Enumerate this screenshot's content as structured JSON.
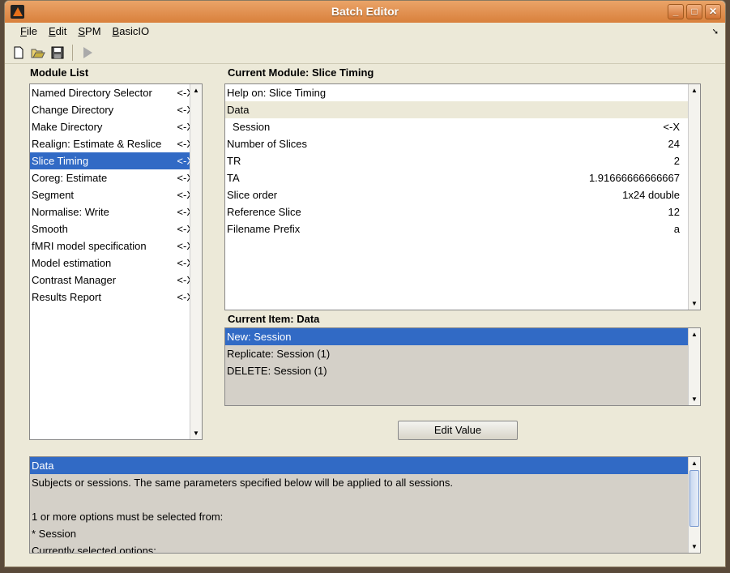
{
  "window": {
    "title": "Batch Editor",
    "buttons": [
      "_",
      "□",
      "✕"
    ]
  },
  "menu": [
    {
      "key": "F",
      "rest": "ile"
    },
    {
      "key": "E",
      "rest": "dit"
    },
    {
      "key": "S",
      "rest": "PM"
    },
    {
      "key": "B",
      "rest": "asicIO"
    }
  ],
  "module_list": {
    "label": "Module List",
    "items": [
      {
        "name": "Named Directory Selector",
        "mark": "<-X"
      },
      {
        "name": "Change Directory",
        "mark": "<-X"
      },
      {
        "name": "Make Directory",
        "mark": "<-X"
      },
      {
        "name": "Realign: Estimate & Reslice",
        "mark": "<-X"
      },
      {
        "name": "Slice Timing",
        "mark": "<-X"
      },
      {
        "name": "Coreg: Estimate",
        "mark": "<-X"
      },
      {
        "name": "Segment",
        "mark": "<-X"
      },
      {
        "name": "Normalise: Write",
        "mark": "<-X"
      },
      {
        "name": "Smooth",
        "mark": "<-X"
      },
      {
        "name": "fMRI model specification",
        "mark": "<-X"
      },
      {
        "name": "Model estimation",
        "mark": "<-X"
      },
      {
        "name": "Contrast Manager",
        "mark": "<-X"
      },
      {
        "name": "Results Report",
        "mark": "<-X"
      }
    ],
    "selected": 4
  },
  "current_module": {
    "label": "Current Module: Slice Timing",
    "rows": [
      {
        "name": "Help on: Slice Timing",
        "value": ""
      },
      {
        "name": "Data",
        "value": ""
      },
      {
        "name": " Session",
        "value": "<-X"
      },
      {
        "name": "Number of Slices",
        "value": "24"
      },
      {
        "name": "TR",
        "value": "2"
      },
      {
        "name": "TA",
        "value": "1.91666666666667"
      },
      {
        "name": "Slice order",
        "value": "1x24 double"
      },
      {
        "name": "Reference Slice",
        "value": "12"
      },
      {
        "name": "Filename Prefix",
        "value": "a"
      }
    ]
  },
  "current_item": {
    "label": "Current Item: Data",
    "items": [
      "New: Session",
      "Replicate: Session (1)",
      "DELETE: Session (1)"
    ]
  },
  "edit_value_label": "Edit Value",
  "help": {
    "lines": [
      "Data",
      "Subjects or sessions. The same parameters specified below will be applied to all sessions.",
      "",
      "1 or more options must be selected from:",
      "* Session",
      "Currently selected options:"
    ]
  }
}
